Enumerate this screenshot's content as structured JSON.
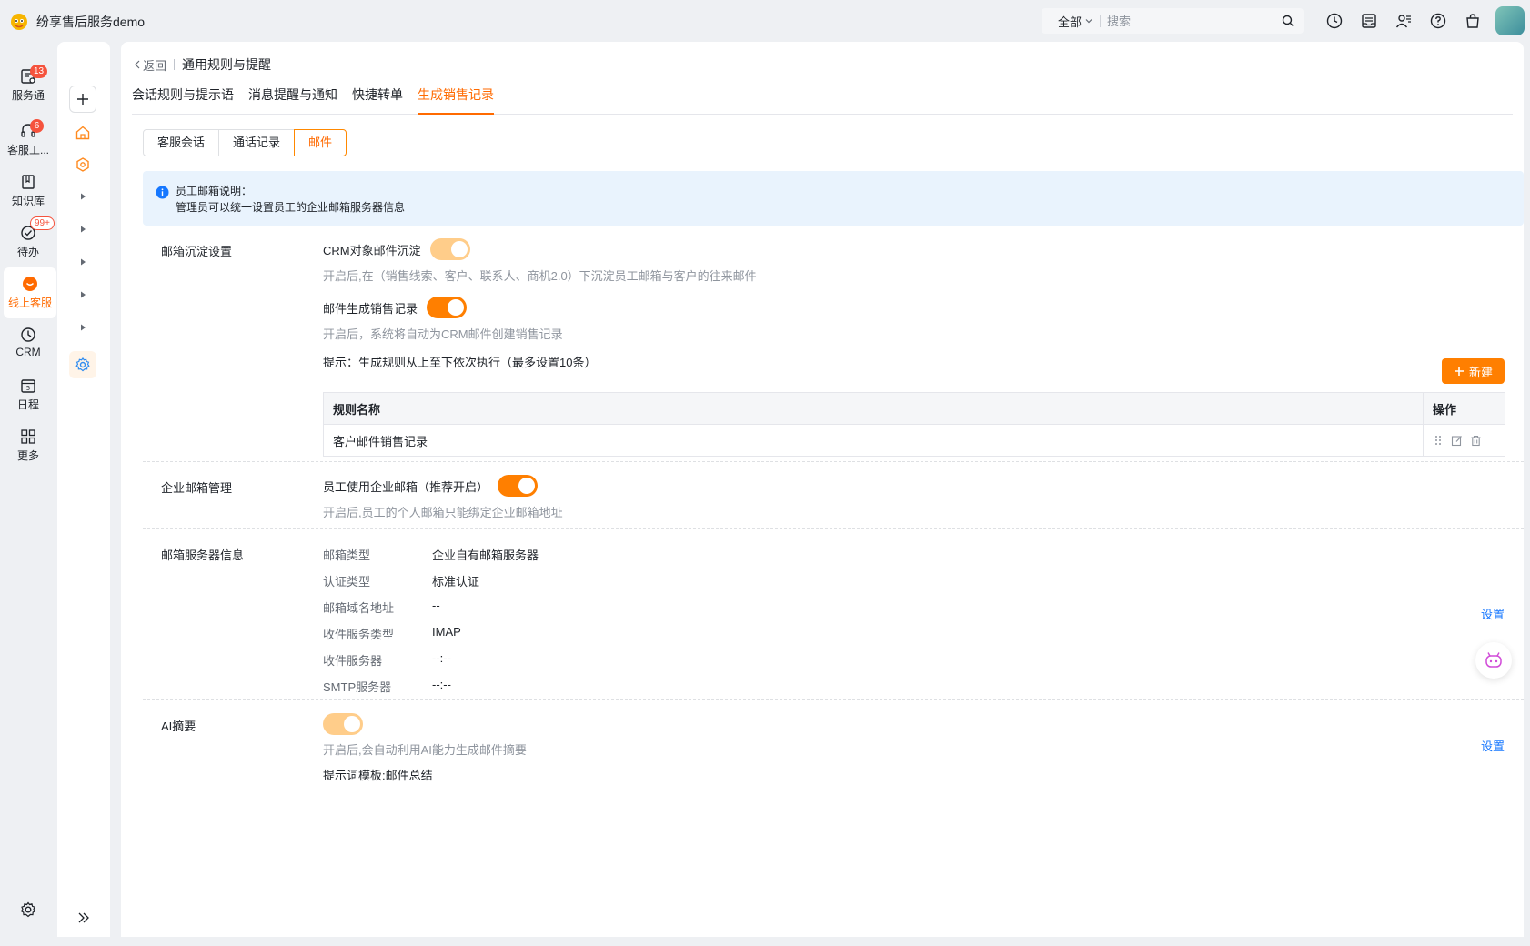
{
  "app": {
    "title": "纷享售后服务demo"
  },
  "search": {
    "scope": "全部",
    "placeholder": "搜索"
  },
  "leftnav": {
    "items": [
      {
        "label": "服务通",
        "badge": "13"
      },
      {
        "label": "客服工...",
        "badge": "6"
      },
      {
        "label": "知识库"
      },
      {
        "label": "待办",
        "badge": "99+"
      },
      {
        "label": "线上客服"
      },
      {
        "label": "CRM"
      },
      {
        "label": "日程"
      },
      {
        "label": "更多"
      }
    ]
  },
  "breadcrumb": {
    "back": "返回",
    "title": "通用规则与提醒"
  },
  "tabs": [
    "会话规则与提示语",
    "消息提醒与通知",
    "快捷转单",
    "生成销售记录"
  ],
  "segments": [
    "客服会话",
    "通话记录",
    "邮件"
  ],
  "info": {
    "line1": "员工邮箱说明：",
    "line2": "管理员可以统一设置员工的企业邮箱服务器信息"
  },
  "sections": {
    "archive": {
      "title": "邮箱沉淀设置",
      "crm_toggle_label": "CRM对象邮件沉淀",
      "crm_desc": "开启后,在（销售线索、客户、联系人、商机2.0）下沉淀员工邮箱与客户的往来邮件",
      "sales_toggle_label": "邮件生成销售记录",
      "sales_desc": "开启后，系统将自动为CRM邮件创建销售记录",
      "hint": "提示：生成规则从上至下依次执行（最多设置10条）",
      "new_button": "新建",
      "table_headers": {
        "name": "规则名称",
        "ops": "操作"
      },
      "rules": [
        {
          "name": "客户邮件销售记录"
        }
      ]
    },
    "enterprise": {
      "title": "企业邮箱管理",
      "toggle_label": "员工使用企业邮箱（推荐开启）",
      "desc": "开启后,员工的个人邮箱只能绑定企业邮箱地址"
    },
    "server": {
      "title": "邮箱服务器信息",
      "rows": [
        {
          "k": "邮箱类型",
          "v": "企业自有邮箱服务器"
        },
        {
          "k": "认证类型",
          "v": "标准认证"
        },
        {
          "k": "邮箱域名地址",
          "v": "--"
        },
        {
          "k": "收件服务类型",
          "v": "IMAP"
        },
        {
          "k": "收件服务器",
          "v": "--:--"
        },
        {
          "k": "SMTP服务器",
          "v": "--:--"
        }
      ],
      "settings_link": "设置"
    },
    "ai": {
      "title": "AI摘要",
      "desc": "开启后,会自动利用AI能力生成邮件摘要",
      "template": "提示词模板:邮件总结",
      "settings_link": "设置"
    }
  },
  "colors": {
    "accent": "#ff7f00",
    "link": "#1677ff",
    "badge": "#f5533d"
  }
}
